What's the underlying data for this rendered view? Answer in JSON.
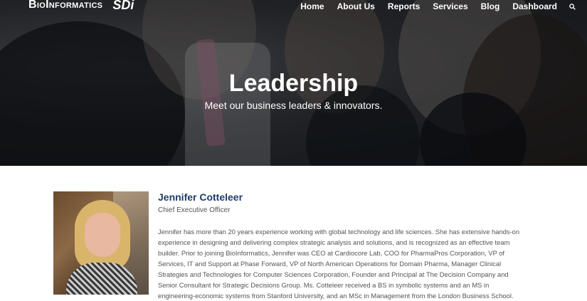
{
  "header": {
    "logo_text": "BioInformatics",
    "logo_secondary": "SDi",
    "nav": [
      "Home",
      "About Us",
      "Reports",
      "Services",
      "Blog",
      "Dashboard"
    ],
    "search_icon": "search-icon"
  },
  "hero": {
    "title": "Leadership",
    "subtitle": "Meet our business leaders & innovators."
  },
  "profile": {
    "name": "Jennifer Cotteleer",
    "role": "Chief Executive Officer",
    "bio": "Jennifer has more than 20 years experience working with global technology and life sciences. She has extensive hands-on experience in designing and delivering complex strategic analysis and solutions, and is recognized as an effective team builder. Prior to joining BioInformatics, Jennifer was CEO at Cardiocore Lab, COO for PharmaPros Corporation, VP of Services, IT and Support at Phase Forward, VP of North American Operations for Domain Pharma, Manager Clinical Strategies and Technologies for Computer Sciences Corporation, Founder and Principal at The Decision Company and Senior Consultant for Strategic Decisions Group. Ms. Cotteleer received a BS in symbolic systems and an MS in engineering-economic systems from Stanford University, and an MSc in Management from the London Business School."
  },
  "colors": {
    "name": "#1f3d6b",
    "body_text": "#555555",
    "nav_text": "#ffffff"
  }
}
